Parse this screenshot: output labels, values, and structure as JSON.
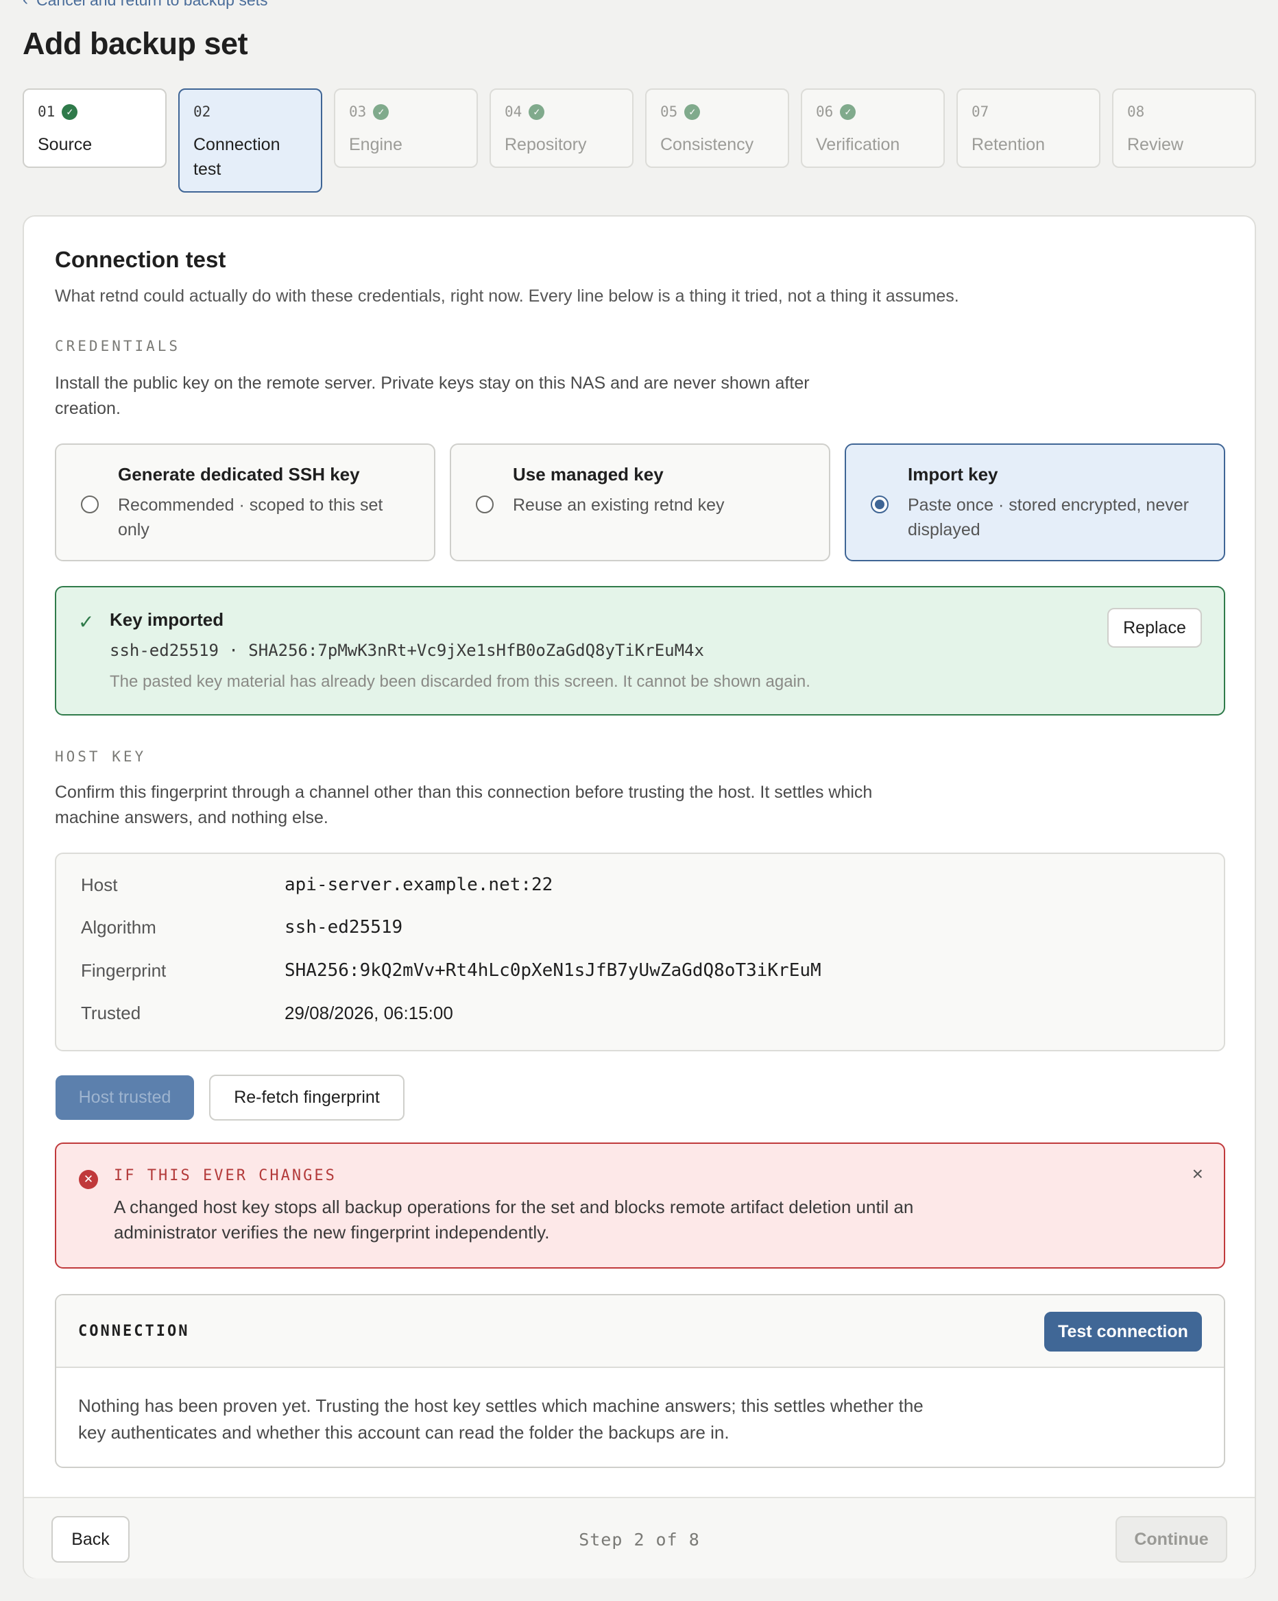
{
  "nav": {
    "back_label": "Cancel and return to backup sets"
  },
  "page": {
    "title": "Add backup set"
  },
  "steps": [
    {
      "num": "01",
      "label": "Source",
      "done": true
    },
    {
      "num": "02",
      "label": "Connection test",
      "done": false
    },
    {
      "num": "03",
      "label": "Engine",
      "done": true
    },
    {
      "num": "04",
      "label": "Repository",
      "done": true
    },
    {
      "num": "05",
      "label": "Consistency",
      "done": true
    },
    {
      "num": "06",
      "label": "Verification",
      "done": true
    },
    {
      "num": "07",
      "label": "Retention",
      "done": false
    },
    {
      "num": "08",
      "label": "Review",
      "done": false
    }
  ],
  "section": {
    "title": "Connection test",
    "description": "What retnd could actually do with these credentials, right now. Every line below is a thing it tried, not a thing it assumes."
  },
  "credentials": {
    "eyebrow": "CREDENTIALS",
    "description": "Install the public key on the remote server. Private keys stay on this NAS and are never shown after creation.",
    "options": [
      {
        "title": "Generate dedicated SSH key",
        "subtitle": "Recommended · scoped to this set only",
        "selected": false
      },
      {
        "title": "Use managed key",
        "subtitle": "Reuse an existing retnd key",
        "selected": false
      },
      {
        "title": "Import key",
        "subtitle": "Paste once · stored encrypted, never displayed",
        "selected": true
      }
    ],
    "imported": {
      "title": "Key imported",
      "fingerprint": "ssh-ed25519 · SHA256:7pMwK3nRt+Vc9jXe1sHfB0oZaGdQ8yTiKrEuM4x",
      "note": "The pasted key material has already been discarded from this screen. It cannot be shown again.",
      "replace_label": "Replace"
    }
  },
  "host_key": {
    "eyebrow": "HOST KEY",
    "description": "Confirm this fingerprint through a channel other than this connection before trusting the host. It settles which machine answers, and nothing else.",
    "rows": [
      {
        "key": "Host",
        "value": "api-server.example.net:22"
      },
      {
        "key": "Algorithm",
        "value": "ssh-ed25519"
      },
      {
        "key": "Fingerprint",
        "value": "SHA256:9kQ2mVv+Rt4hLc0pXeN1sJfB7yUwZaGdQ8oT3iKrEuM"
      },
      {
        "key": "Trusted",
        "value": "29/08/2026, 06:15:00"
      }
    ],
    "trusted_label": "Host trusted",
    "refetch_label": "Re-fetch fingerprint"
  },
  "alert": {
    "title": "IF THIS EVER CHANGES",
    "body": "A changed host key stops all backup operations for the set and blocks remote artifact deletion until an administrator verifies the new fingerprint independently.",
    "close": "×"
  },
  "connection": {
    "label": "CONNECTION",
    "test_label": "Test connection",
    "body": "Nothing has been proven yet. Trusting the host key settles which machine answers; this settles whether the key authenticates and whether this account can read the folder the backups are in."
  },
  "footer": {
    "back_label": "Back",
    "step_text": "Step 2 of 8",
    "continue_label": "Continue"
  },
  "colors": {
    "accent": "#406796",
    "success": "#2f7a4a",
    "danger": "#c0393b"
  }
}
